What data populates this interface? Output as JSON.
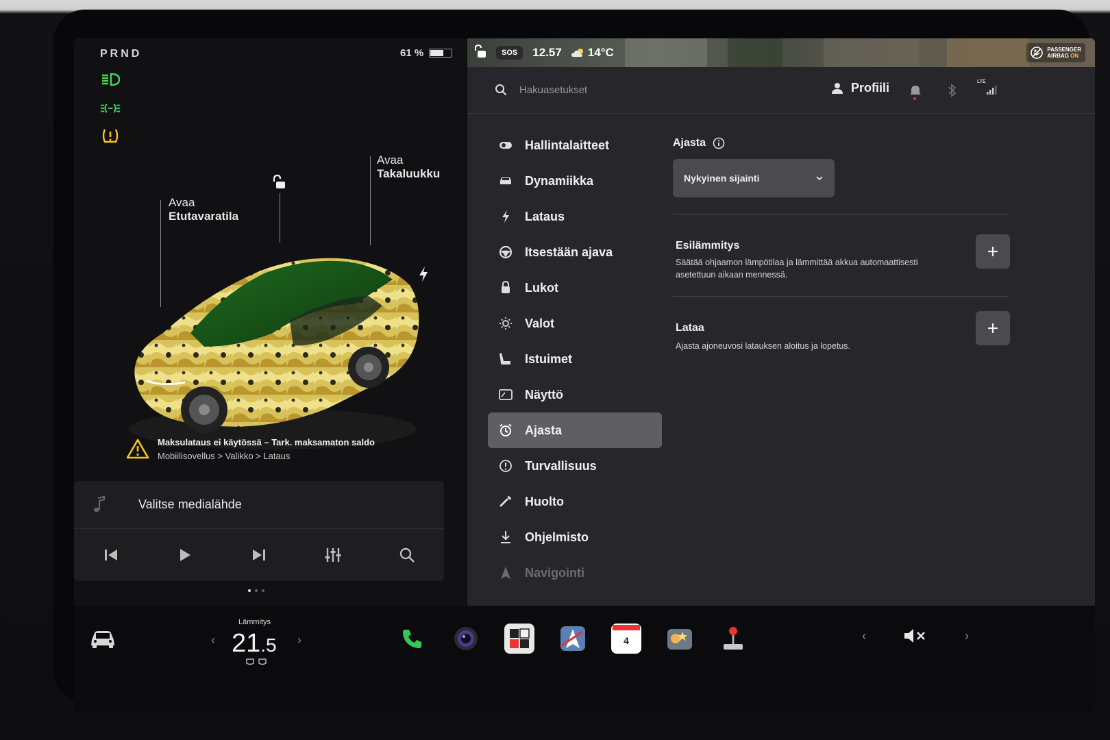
{
  "car": {
    "gear": "PRND",
    "battery_percent_label": "61 %",
    "battery_level": 0.61,
    "label_frunk_action": "Avaa",
    "label_frunk": "Etutavaratila",
    "label_trunk_action": "Avaa",
    "label_trunk": "Takaluukku",
    "alert_title": "Maksulataus ei käytössä – Tark. maksamaton saldo",
    "alert_path": "Mobiilisovellus > Valikko > Lataus"
  },
  "media": {
    "source_label": "Valitse medialähde"
  },
  "statusbar": {
    "sos": "SOS",
    "time": "12.57",
    "temperature": "14°C",
    "airbag_line1": "PASSENGER",
    "airbag_line2": "AIRBAG",
    "airbag_state": "ON"
  },
  "topbar": {
    "search_placeholder": "Hakuasetukset",
    "profile_label": "Profiili",
    "lte": "LTE"
  },
  "menu": {
    "items": [
      {
        "label": "Hallintalaitteet",
        "icon": "toggle-icon"
      },
      {
        "label": "Dynamiikka",
        "icon": "car-icon"
      },
      {
        "label": "Lataus",
        "icon": "bolt-icon"
      },
      {
        "label": "Itsestään ajava",
        "icon": "steering-wheel-icon"
      },
      {
        "label": "Lukot",
        "icon": "lock-icon"
      },
      {
        "label": "Valot",
        "icon": "sun-icon"
      },
      {
        "label": "Istuimet",
        "icon": "seat-icon"
      },
      {
        "label": "Näyttö",
        "icon": "display-icon"
      },
      {
        "label": "Ajasta",
        "icon": "alarm-clock-icon",
        "active": true
      },
      {
        "label": "Turvallisuus",
        "icon": "alert-circle-icon"
      },
      {
        "label": "Huolto",
        "icon": "wrench-icon"
      },
      {
        "label": "Ohjelmisto",
        "icon": "download-icon"
      },
      {
        "label": "Navigointi",
        "icon": "navigation-icon"
      }
    ]
  },
  "schedule": {
    "title": "Ajasta",
    "location_value": "Nykyinen sijainti",
    "preheat_title": "Esilämmitys",
    "preheat_desc": "Säätää ohjaamon lämpötilaa ja lämmittää akkua automaattisesti asetettuun aikaan mennessä.",
    "charge_title": "Lataa",
    "charge_desc": "Ajasta ajoneuvosi latauksen aloitus ja lopetus."
  },
  "taskbar": {
    "heating_label": "Lämmitys",
    "temp_int": "21",
    "temp_dec": ".5",
    "calendar_day": "4"
  },
  "colors": {
    "indicator_green": "#3ddc5a",
    "indicator_yellow": "#f5c518",
    "phone_green": "#34c759",
    "settings_bg": "#27272b",
    "active_item": "#5e5e63"
  }
}
